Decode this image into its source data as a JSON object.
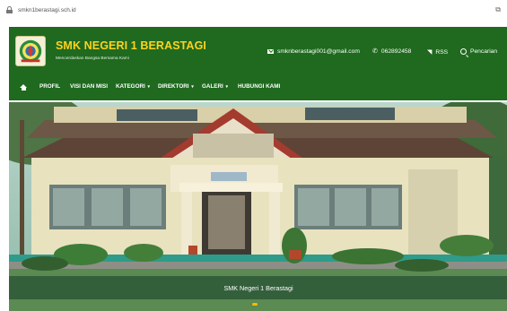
{
  "browser": {
    "url": "smkn1berastagi.sch.id",
    "lock_icon": "lock-icon",
    "extension_icon": "puzzle-icon",
    "extension_glyph": "⧉"
  },
  "header": {
    "title": "SMK NEGERI 1 BERASTAGI",
    "tagline": "Mencerdaskan Bangsa Bersama Kami",
    "email": "smknberastagi001@gmail.com",
    "phone": "062892458",
    "rss_label": "RSS",
    "search_label": "Pencarian",
    "colors": {
      "header_bg": "#1f6a1f",
      "title": "#ffd21f"
    }
  },
  "nav": {
    "items": [
      {
        "label": "PROFIL"
      },
      {
        "label": "VISI DAN MISI"
      },
      {
        "label": "KATEGORI",
        "caret": "▾"
      },
      {
        "label": "DIREKTORI",
        "caret": "▾"
      },
      {
        "label": "GALERI",
        "caret": "▾"
      },
      {
        "label": "HUBUNGI KAMI"
      }
    ]
  },
  "slider": {
    "caption": "SMK Negeri 1 Berastagi"
  }
}
